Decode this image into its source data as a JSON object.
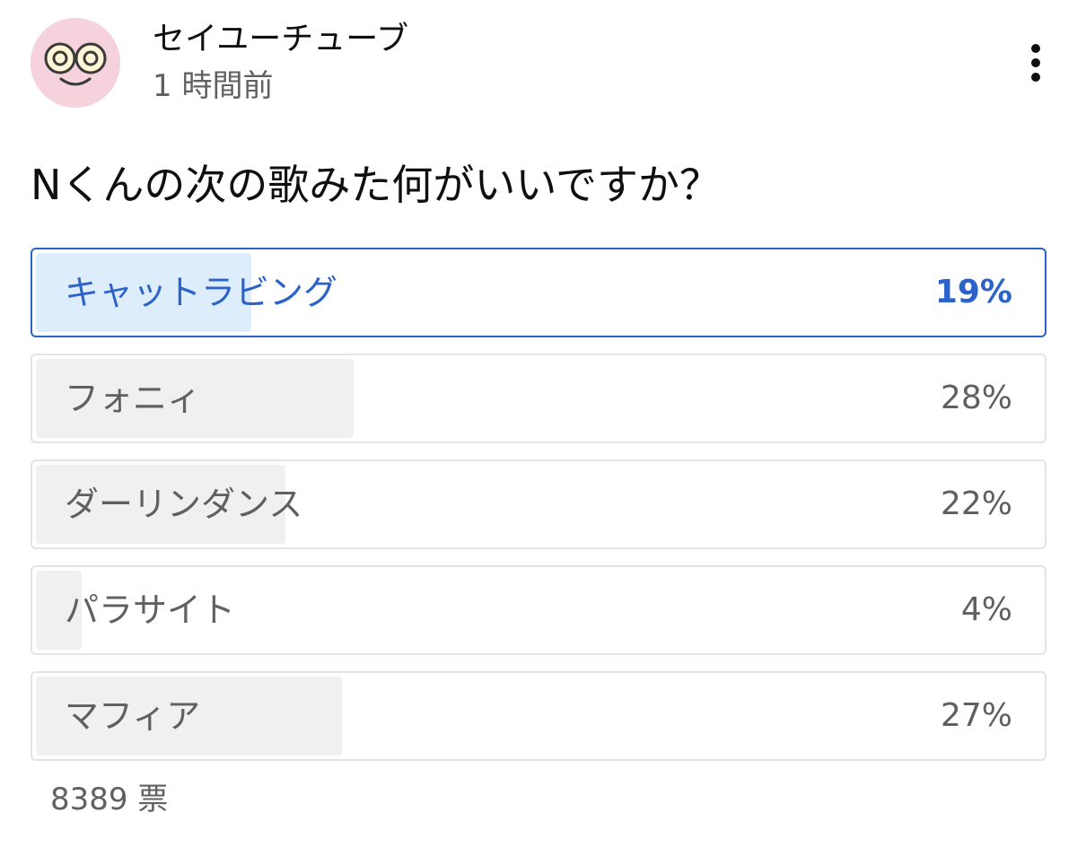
{
  "post": {
    "channel_name": "セイユーチューブ",
    "time_ago": "1 時間前",
    "menu_icon": "more-vertical-icon",
    "avatar_icon": "face-avatar-icon"
  },
  "poll": {
    "question": "Nくんの次の歌みた何がいいですか？",
    "options": [
      {
        "label": "キャットラビング",
        "percent_text": "19%",
        "percent": 19,
        "selected": true
      },
      {
        "label": "フォニィ",
        "percent_text": "28%",
        "percent": 28,
        "selected": false
      },
      {
        "label": "ダーリンダンス",
        "percent_text": "22%",
        "percent": 22,
        "selected": false
      },
      {
        "label": "パラサイト",
        "percent_text": "4%",
        "percent": 4,
        "selected": false
      },
      {
        "label": "マフィア",
        "percent_text": "27%",
        "percent": 27,
        "selected": false
      }
    ],
    "vote_count": "8389 票"
  },
  "colors": {
    "accent": "#2b63c9",
    "selected_fill": "#deedfb",
    "result_fill": "#f0f0f0",
    "border": "#e3e3e3",
    "secondary_text": "#606060"
  }
}
